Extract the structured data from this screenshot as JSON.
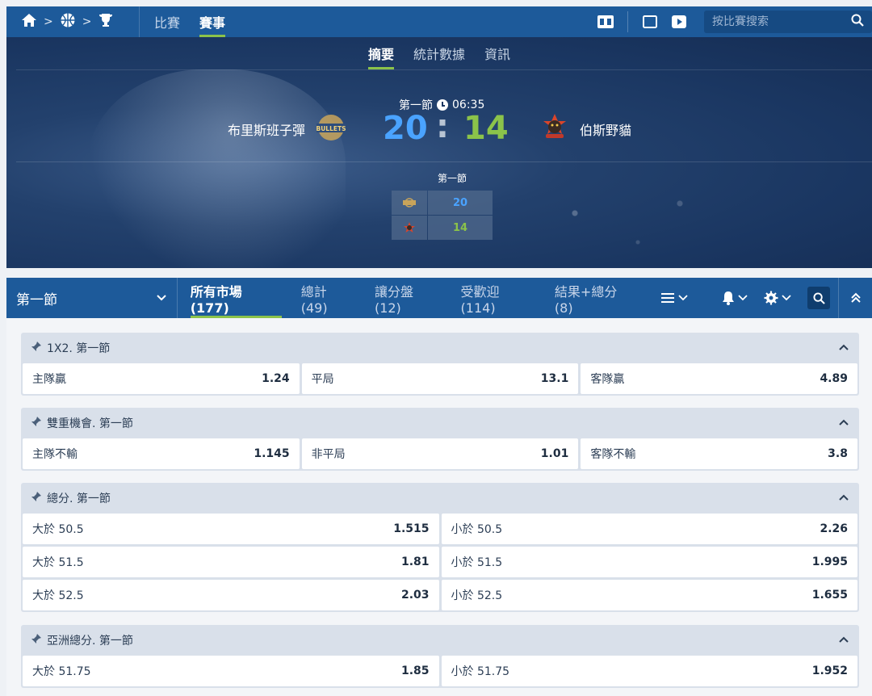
{
  "nav": {
    "tabs": [
      "比賽",
      "賽事"
    ],
    "active_tab": "賽事",
    "search_placeholder": "按比賽搜索"
  },
  "subtabs": [
    "摘要",
    "統計數據",
    "資訊"
  ],
  "match": {
    "period": "第一節",
    "time": "06:35",
    "home": {
      "name": "布里斯班子彈",
      "score": "20",
      "logo_text": "BULLETS"
    },
    "away": {
      "name": "伯斯野貓",
      "score": "14"
    },
    "colon": ":",
    "mini": {
      "title": "第一節",
      "home": "20",
      "away": "14"
    }
  },
  "marketbar": {
    "period_select": "第一節",
    "tabs": [
      "所有市場 (177)",
      "總計 (49)",
      "讓分盤 (12)",
      "受歡迎 (114)",
      "結果+總分 (8)"
    ]
  },
  "markets": [
    {
      "title": "1X2. 第一節",
      "rows": [
        [
          {
            "label": "主隊贏",
            "value": "1.24"
          },
          {
            "label": "平局",
            "value": "13.1"
          },
          {
            "label": "客隊贏",
            "value": "4.89"
          }
        ]
      ]
    },
    {
      "title": "雙重機會. 第一節",
      "rows": [
        [
          {
            "label": "主隊不輸",
            "value": "1.145"
          },
          {
            "label": "非平局",
            "value": "1.01"
          },
          {
            "label": "客隊不輸",
            "value": "3.8"
          }
        ]
      ]
    },
    {
      "title": "總分. 第一節",
      "rows": [
        [
          {
            "label": "大於 50.5",
            "value": "1.515"
          },
          {
            "label": "小於 50.5",
            "value": "2.26"
          }
        ],
        [
          {
            "label": "大於 51.5",
            "value": "1.81"
          },
          {
            "label": "小於 51.5",
            "value": "1.995"
          }
        ],
        [
          {
            "label": "大於 52.5",
            "value": "2.03"
          },
          {
            "label": "小於 52.5",
            "value": "1.655"
          }
        ]
      ]
    },
    {
      "title": "亞洲總分. 第一節",
      "rows": [
        [
          {
            "label": "大於 51.75",
            "value": "1.85"
          },
          {
            "label": "小於 51.75",
            "value": "1.952"
          }
        ]
      ]
    }
  ]
}
